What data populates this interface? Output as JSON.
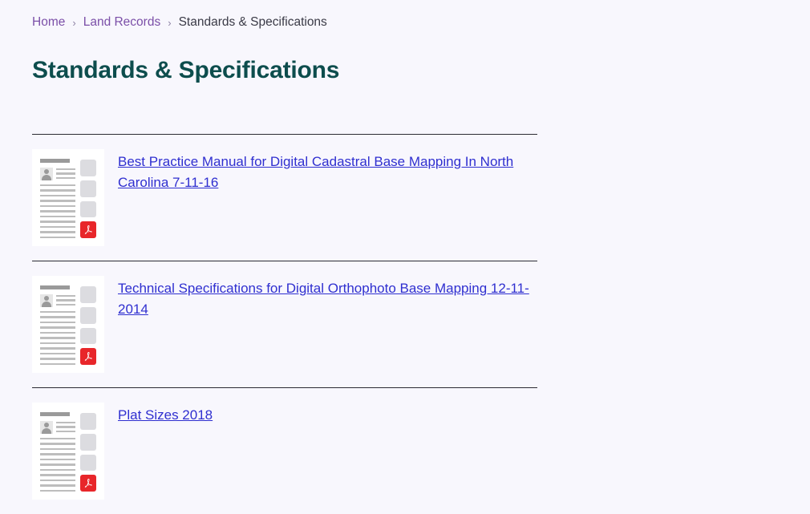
{
  "breadcrumb": {
    "items": [
      {
        "label": "Home",
        "type": "link"
      },
      {
        "label": "Land Records",
        "type": "link"
      },
      {
        "label": "Standards & Specifications",
        "type": "current"
      }
    ],
    "separator": "›"
  },
  "header": {
    "title": "Standards & Specifications"
  },
  "colors": {
    "page_background": "#f8f7fd",
    "heading": "#0d4d4d",
    "breadcrumb_link": "#7b4fa8",
    "breadcrumb_current": "#3a3a46",
    "document_link": "#2f2fd0",
    "divider": "#2b2b33",
    "pdf_badge": "#e8262a",
    "thumbnail_background": "#ffffff"
  },
  "documents": [
    {
      "title": "Best Practice Manual for Digital Cadastral Base Mapping In North Carolina 7-11-16",
      "file_type": "PDF",
      "thumbnail": "document-preview-thumbnail"
    },
    {
      "title": "Technical Specifications for Digital Orthophoto Base Mapping 12-11-2014",
      "file_type": "PDF",
      "thumbnail": "document-preview-thumbnail"
    },
    {
      "title": "Plat Sizes 2018",
      "file_type": "PDF",
      "thumbnail": "document-preview-thumbnail"
    }
  ]
}
